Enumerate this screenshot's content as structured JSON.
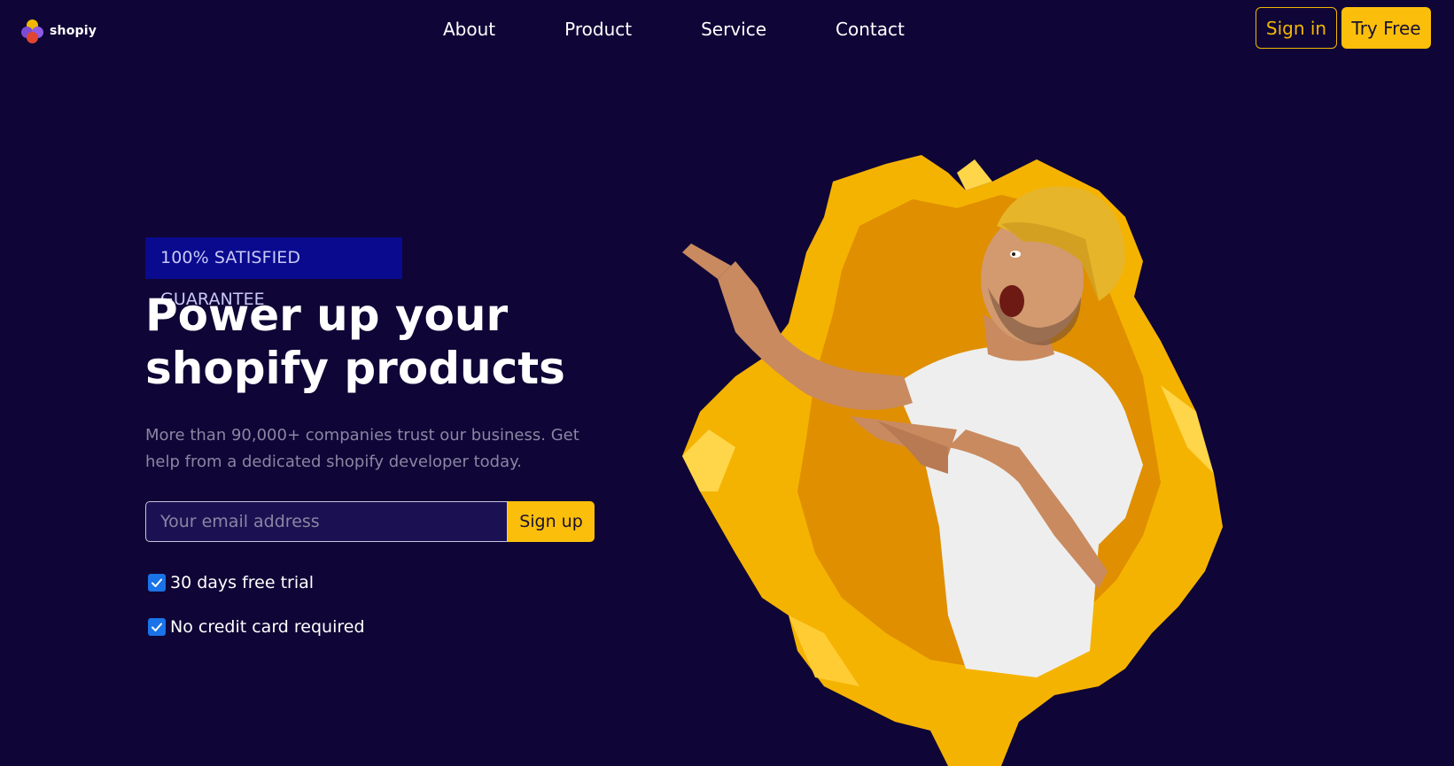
{
  "header": {
    "logo_text": "shopiy",
    "nav": [
      "About",
      "Product",
      "Service",
      "Contact"
    ],
    "signin_label": "Sign in",
    "tryfree_label": "Try Free"
  },
  "hero": {
    "badge": "100% SATISFIED GUARANTEE",
    "headline_line1": "Power up your",
    "headline_line2": "shopify products",
    "subtext": "More than 90,000+ companies trust our business. Get help from a dedicated shopify developer today.",
    "email_placeholder": "Your email address",
    "signup_label": "Sign up",
    "checks": [
      "30 days free trial",
      "No credit card required"
    ]
  },
  "colors": {
    "background": "#0f0536",
    "accent": "#fbbf0b",
    "badge_bg": "#0a0a8f",
    "checkbox": "#1a73e8"
  },
  "icons": {
    "logo": "four-circles-logo-icon",
    "check": "checkmark-icon"
  }
}
